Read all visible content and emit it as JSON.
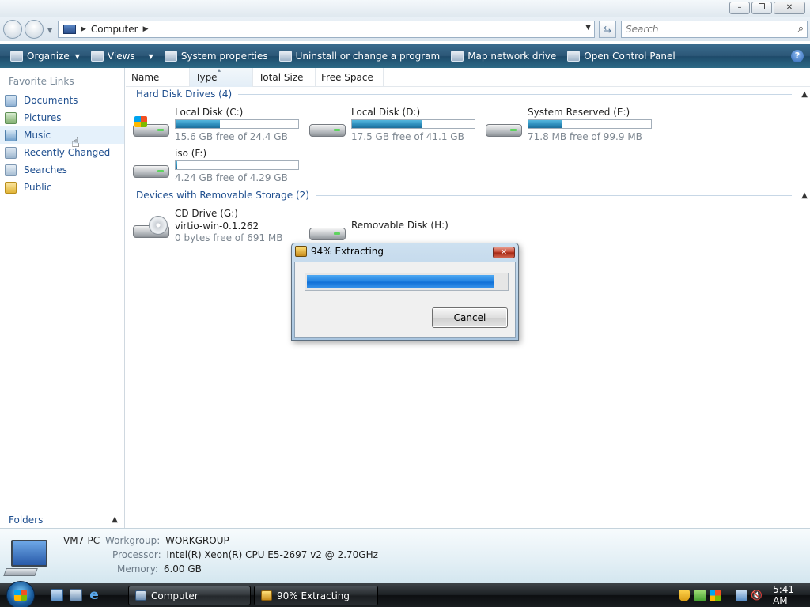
{
  "window": {
    "controls": {
      "minimize": "–",
      "maximize": "❐",
      "close": "✕"
    }
  },
  "address": {
    "location": "Computer",
    "refresh_icon": "⇆"
  },
  "search": {
    "placeholder": "Search",
    "icon": "⌕"
  },
  "commandbar": {
    "items": [
      {
        "label": "Organize",
        "icon": "organize-icon",
        "has_menu": true
      },
      {
        "label": "Views",
        "icon": "views-icon",
        "has_menu": true
      },
      {
        "label": "System properties",
        "icon": "system-properties-icon"
      },
      {
        "label": "Uninstall or change a program",
        "icon": "uninstall-icon"
      },
      {
        "label": "Map network drive",
        "icon": "network-drive-icon"
      },
      {
        "label": "Open Control Panel",
        "icon": "control-panel-icon"
      }
    ],
    "help": "?"
  },
  "sidebar": {
    "heading": "Favorite Links",
    "items": [
      {
        "label": "Documents",
        "icon": "documents-icon"
      },
      {
        "label": "Pictures",
        "icon": "pictures-icon"
      },
      {
        "label": "Music",
        "icon": "music-icon"
      },
      {
        "label": "Recently Changed",
        "icon": "recently-changed-icon"
      },
      {
        "label": "Searches",
        "icon": "searches-icon"
      },
      {
        "label": "Public",
        "icon": "public-folder-icon"
      }
    ],
    "folders_label": "Folders"
  },
  "columns": [
    "Name",
    "Type",
    "Total Size",
    "Free Space"
  ],
  "groups": {
    "hard_disks": {
      "title": "Hard Disk Drives (4)",
      "drives": [
        {
          "name": "Local Disk (C:)",
          "free": "15.6 GB free of 24.4 GB",
          "used_fraction": 0.36
        },
        {
          "name": "Local Disk (D:)",
          "free": "17.5 GB free of 41.1 GB",
          "used_fraction": 0.57
        },
        {
          "name": "System Reserved (E:)",
          "free": "71.8 MB free of 99.9 MB",
          "used_fraction": 0.28
        },
        {
          "name": "iso (F:)",
          "free": "4.24 GB free of 4.29 GB",
          "used_fraction": 0.01
        }
      ]
    },
    "removable": {
      "title": "Devices with Removable Storage (2)",
      "drives": [
        {
          "name": "CD Drive (G:)",
          "sub": "virtio-win-0.1.262",
          "free": "0 bytes free of 691 MB"
        },
        {
          "name": "Removable Disk (H:)"
        }
      ]
    }
  },
  "details": {
    "computer_name": "VM7-PC",
    "workgroup_label": "Workgroup:",
    "workgroup": "WORKGROUP",
    "processor_label": "Processor:",
    "processor": "Intel(R) Xeon(R) CPU E5-2697 v2 @ 2.70GHz",
    "memory_label": "Memory:",
    "memory": "6.00 GB"
  },
  "dialog": {
    "title": "94% Extracting",
    "progress_percent": 94,
    "cancel_label": "Cancel",
    "close": "✕"
  },
  "taskbar": {
    "tasks": [
      {
        "label": "Computer"
      },
      {
        "label": "90% Extracting"
      }
    ],
    "volume_icon": "🔇",
    "ie_icon": "e",
    "clock": "5:41 AM"
  },
  "colors": {
    "command_bar": "#2b5676",
    "link_text": "#1f4f8f",
    "drive_bar_fill": "#2b8ab9",
    "progress_fill": "#1f7fe0"
  }
}
